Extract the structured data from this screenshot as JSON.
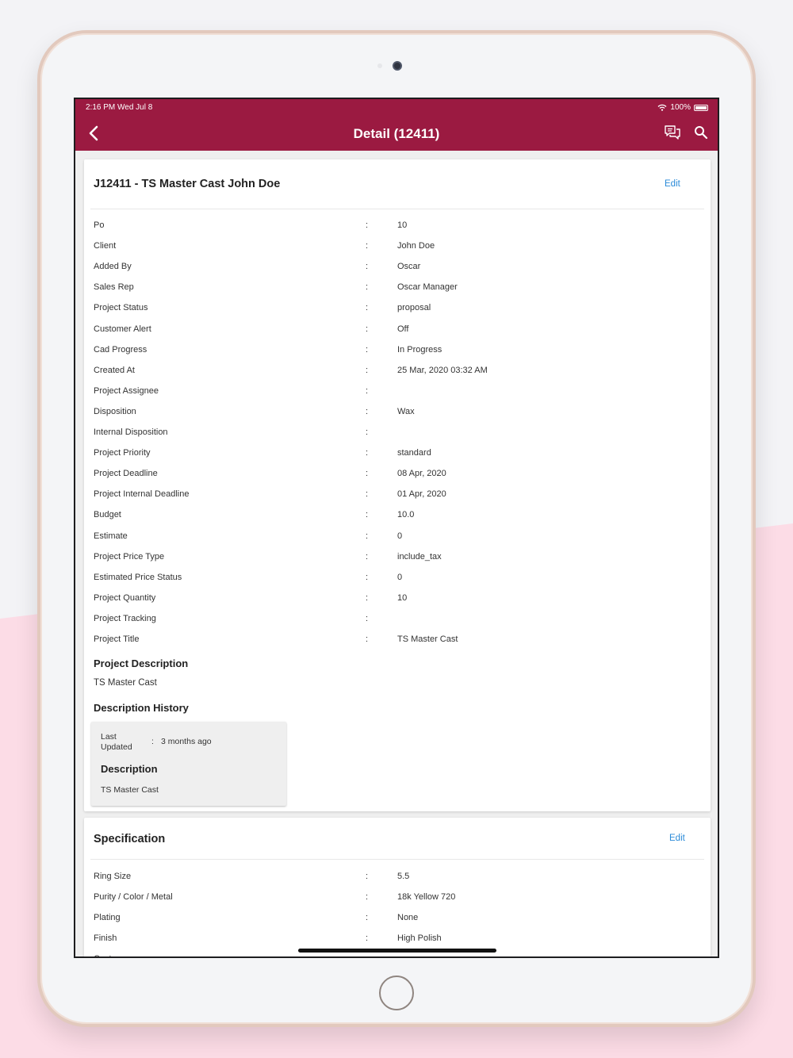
{
  "status_bar": {
    "time": "2:16 PM   Wed Jul 8",
    "battery": "100%"
  },
  "header": {
    "title": "Detail (12411)"
  },
  "icons": {
    "back": "chevron-left-icon",
    "chat": "chat-icon",
    "search": "search-icon"
  },
  "colors": {
    "appbar": "#9b1a41",
    "edit_link": "#2a8ad8"
  },
  "project": {
    "title": "J12411 - TS Master Cast John Doe",
    "edit_label": "Edit",
    "rows": [
      {
        "label": "Po",
        "value": "10"
      },
      {
        "label": "Client",
        "value": "John Doe"
      },
      {
        "label": "Added By",
        "value": "Oscar"
      },
      {
        "label": "Sales Rep",
        "value": "Oscar Manager"
      },
      {
        "label": "Project Status",
        "value": "proposal"
      },
      {
        "label": "Customer Alert",
        "value": "Off"
      },
      {
        "label": "Cad Progress",
        "value": "In Progress"
      },
      {
        "label": "Created At",
        "value": "25 Mar, 2020 03:32 AM"
      },
      {
        "label": "Project Assignee",
        "value": ""
      },
      {
        "label": "Disposition",
        "value": "Wax"
      },
      {
        "label": "Internal Disposition",
        "value": ""
      },
      {
        "label": "Project Priority",
        "value": "standard"
      },
      {
        "label": "Project Deadline",
        "value": "08 Apr, 2020"
      },
      {
        "label": "Project Internal Deadline",
        "value": "01 Apr, 2020"
      },
      {
        "label": "Budget",
        "value": "10.0"
      },
      {
        "label": "Estimate",
        "value": "0"
      },
      {
        "label": "Project Price Type",
        "value": "include_tax"
      },
      {
        "label": "Estimated Price Status",
        "value": "0"
      },
      {
        "label": "Project Quantity",
        "value": "10"
      },
      {
        "label": "Project Tracking",
        "value": ""
      },
      {
        "label": "Project Title",
        "value": "TS Master Cast"
      }
    ],
    "separator": ":",
    "description_heading": "Project Description",
    "description_text": "TS Master Cast",
    "history_heading": "Description History",
    "history": {
      "last_updated_label": "Last Updated",
      "last_updated_value": "3 months ago",
      "description_heading": "Description",
      "description_text": "TS Master Cast"
    }
  },
  "specification": {
    "title": "Specification",
    "edit_label": "Edit",
    "rows": [
      {
        "label": "Ring Size",
        "value": "5.5"
      },
      {
        "label": "Purity / Color / Metal",
        "value": "18k Yellow 720"
      },
      {
        "label": "Plating",
        "value": "None"
      },
      {
        "label": "Finish",
        "value": "High Polish"
      },
      {
        "label": "Custom",
        "value": ""
      }
    ]
  }
}
